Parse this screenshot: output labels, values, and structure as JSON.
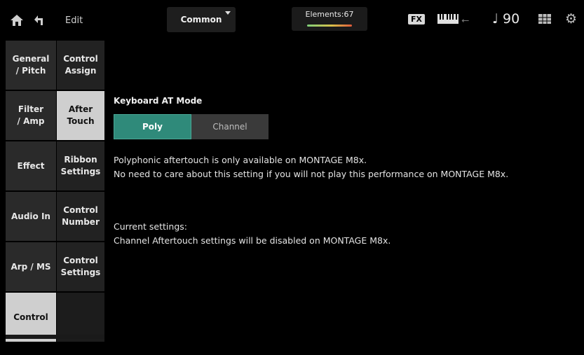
{
  "header": {
    "edit_label": "Edit",
    "part_selector": "Common",
    "elements": "Elements:67",
    "fx_badge": "FX",
    "tempo": "♩ 90",
    "icons": [
      "home-icon",
      "back-arrow-icon",
      "keyboard-icon",
      "usb-icon",
      "quick-access-icon",
      "gear-icon"
    ]
  },
  "category_tabs": [
    {
      "label": "General\n/ Pitch",
      "active": false
    },
    {
      "label": "Filter\n/ Amp",
      "active": false
    },
    {
      "label": "Effect",
      "active": false
    },
    {
      "label": "Audio In",
      "active": false
    },
    {
      "label": "Arp / MS",
      "active": false
    },
    {
      "label": "Control",
      "active": true
    }
  ],
  "sub_tabs": [
    {
      "label": "Control\nAssign",
      "active": false
    },
    {
      "label": "After\nTouch",
      "active": true
    },
    {
      "label": "Ribbon\nSettings",
      "active": false
    },
    {
      "label": "Control\nNumber",
      "active": false
    },
    {
      "label": "Control\nSettings",
      "active": false
    },
    {
      "label": "",
      "active": false
    }
  ],
  "main": {
    "mode_label": "Keyboard AT Mode",
    "options": [
      {
        "label": "Poly",
        "selected": true
      },
      {
        "label": "Channel",
        "selected": false
      }
    ],
    "note_line1": "Polyphonic aftertouch is only available on MONTAGE M8x.",
    "note_line2": "No need to care about this setting if you will not play this performance on MONTAGE M8x.",
    "current_label": "Current settings:",
    "current_line": "Channel Aftertouch settings will be disabled on MONTAGE M8x."
  },
  "colors": {
    "selected_button": "#2f8a7a",
    "active_tab": "#cfcfcf",
    "background": "#000000"
  }
}
